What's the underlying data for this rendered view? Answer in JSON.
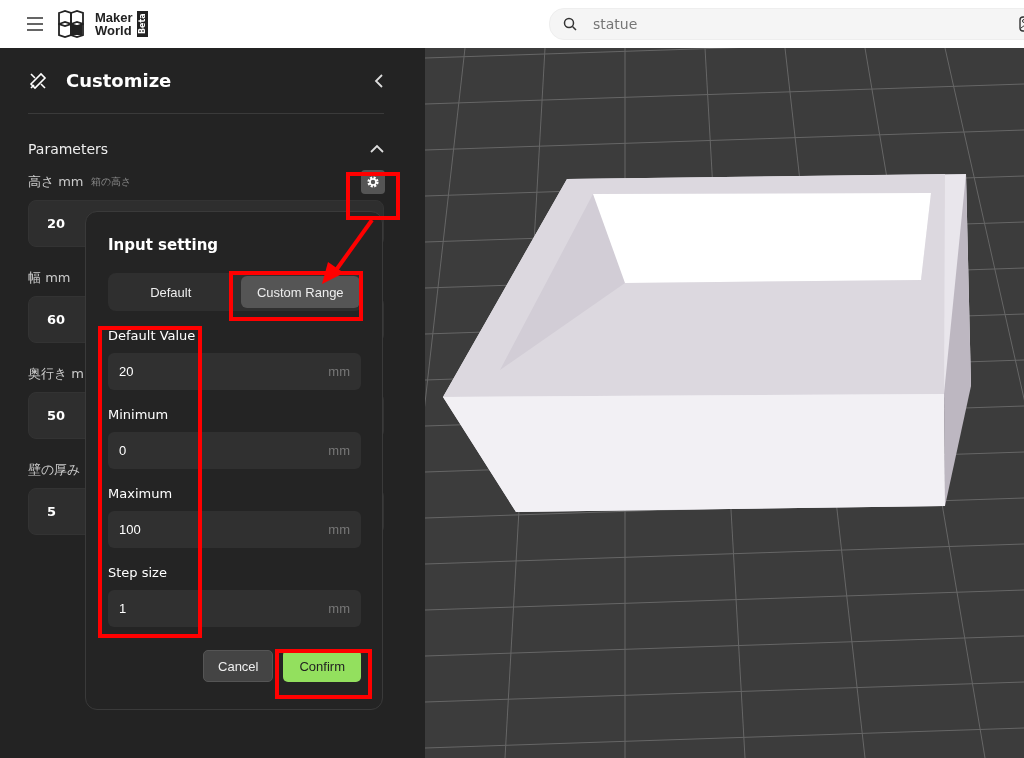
{
  "header": {
    "logo_line1": "Maker",
    "logo_line2": "World",
    "logo_badge": "Beta",
    "search": {
      "placeholder": "statue"
    }
  },
  "sidebar": {
    "title": "Customize",
    "section": {
      "title": "Parameters",
      "expanded": true
    },
    "parameters": [
      {
        "label": "高さ mm",
        "hint": "箱の高さ",
        "value": "20"
      },
      {
        "label": "幅 mm",
        "value": "60"
      },
      {
        "label": "奥行き m",
        "value": "50"
      },
      {
        "label": "壁の厚み",
        "value": "5"
      }
    ]
  },
  "popup": {
    "title": "Input setting",
    "tabs": [
      {
        "label": "Default",
        "selected": false
      },
      {
        "label": "Custom Range",
        "selected": true
      }
    ],
    "fields": [
      {
        "label": "Default Value",
        "value": "20",
        "unit": "mm"
      },
      {
        "label": "Minimum",
        "value": "0",
        "unit": "mm"
      },
      {
        "label": "Maximum",
        "value": "100",
        "unit": "mm"
      },
      {
        "label": "Step size",
        "value": "1",
        "unit": "mm"
      }
    ],
    "buttons": [
      {
        "label": "Cancel",
        "kind": "secondary"
      },
      {
        "label": "Confirm",
        "kind": "primary"
      }
    ]
  }
}
